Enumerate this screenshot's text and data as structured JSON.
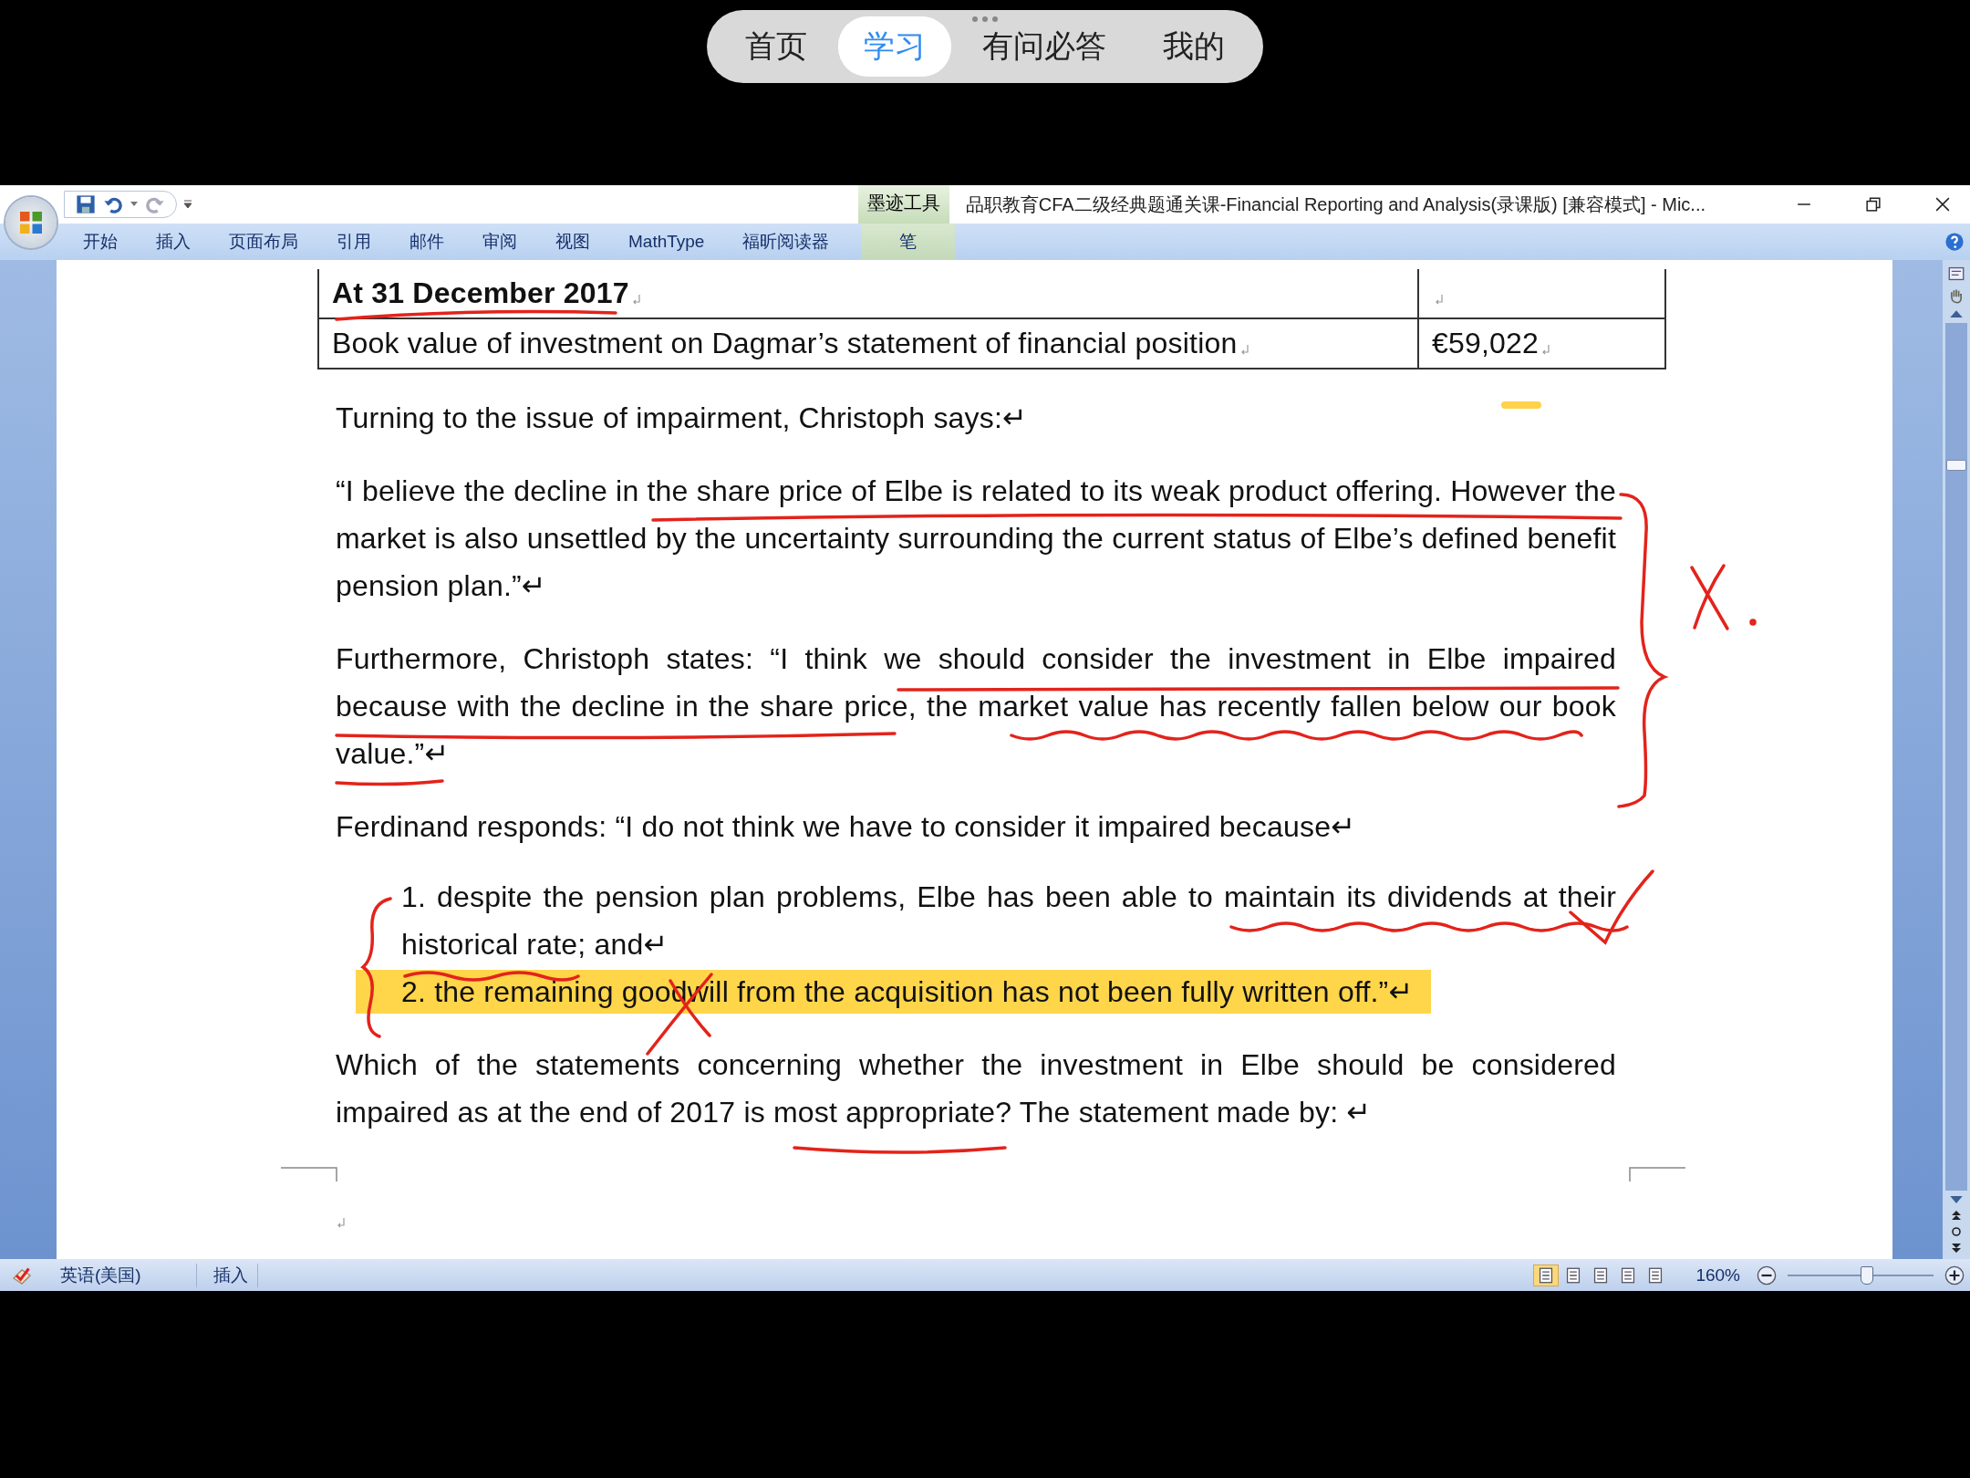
{
  "app_nav": {
    "tabs": [
      {
        "label": "首页",
        "selected": false
      },
      {
        "label": "学习",
        "selected": true
      },
      {
        "label": "有问必答",
        "selected": false
      },
      {
        "label": "我的",
        "selected": false
      }
    ]
  },
  "window": {
    "title": "品职教育CFA二级经典题通关课-Financial Reporting and Analysis(录课版) [兼容模式] - Mic...",
    "contextual_group": "墨迹工具"
  },
  "ribbon": {
    "tabs": [
      {
        "label": "开始",
        "kind": "standard"
      },
      {
        "label": "插入",
        "kind": "standard"
      },
      {
        "label": "页面布局",
        "kind": "standard"
      },
      {
        "label": "引用",
        "kind": "standard"
      },
      {
        "label": "邮件",
        "kind": "standard"
      },
      {
        "label": "审阅",
        "kind": "standard"
      },
      {
        "label": "视图",
        "kind": "standard"
      },
      {
        "label": "MathType",
        "kind": "standard"
      },
      {
        "label": "福昕阅读器",
        "kind": "standard"
      },
      {
        "label": "笔",
        "kind": "contextual"
      }
    ]
  },
  "document": {
    "table": {
      "rows": [
        {
          "bold": true,
          "cells": [
            "At 31 December 2017",
            ""
          ]
        },
        {
          "bold": false,
          "cells": [
            "Book value of investment on Dagmar’s statement of financial position",
            "€59,022"
          ]
        }
      ]
    },
    "paragraphs": [
      {
        "kind": "para",
        "text": "Turning to the issue of impairment, Christoph says:↵"
      },
      {
        "kind": "para",
        "text": " “I believe the decline in the share price of Elbe is related to its weak product offering. However the market is also unsettled by the uncertainty surrounding the current status of Elbe’s defined benefit pension plan.”↵"
      },
      {
        "kind": "para",
        "text": "Furthermore, Christoph states: “I think we should consider the investment in Elbe impaired because with the decline in the share price, the market value has recently fallen below our book value.”↵"
      },
      {
        "kind": "para",
        "text": "Ferdinand responds: “I do not think we have to consider it impaired because↵"
      },
      {
        "kind": "list_item",
        "highlighted": false,
        "text": "1. despite the pension plan problems, Elbe has been able to maintain its dividends at their historical rate; and↵"
      },
      {
        "kind": "list_item",
        "highlighted": true,
        "text": "2. the remaining goodwill from the acquisition has not been fully written off.”↵"
      },
      {
        "kind": "para",
        "text": "Which of the statements concerning whether the investment in Elbe should be considered impaired as at the end of 2017 is most appropriate? The statement made by: ↵"
      }
    ]
  },
  "status_bar": {
    "language": "英语(美国)",
    "mode": "插入",
    "view_buttons": [
      {
        "selected": true
      },
      {
        "selected": false
      },
      {
        "selected": false
      },
      {
        "selected": false
      },
      {
        "selected": false
      }
    ],
    "zoom": "160%",
    "zoom_slider": {
      "level": 0.54
    }
  }
}
